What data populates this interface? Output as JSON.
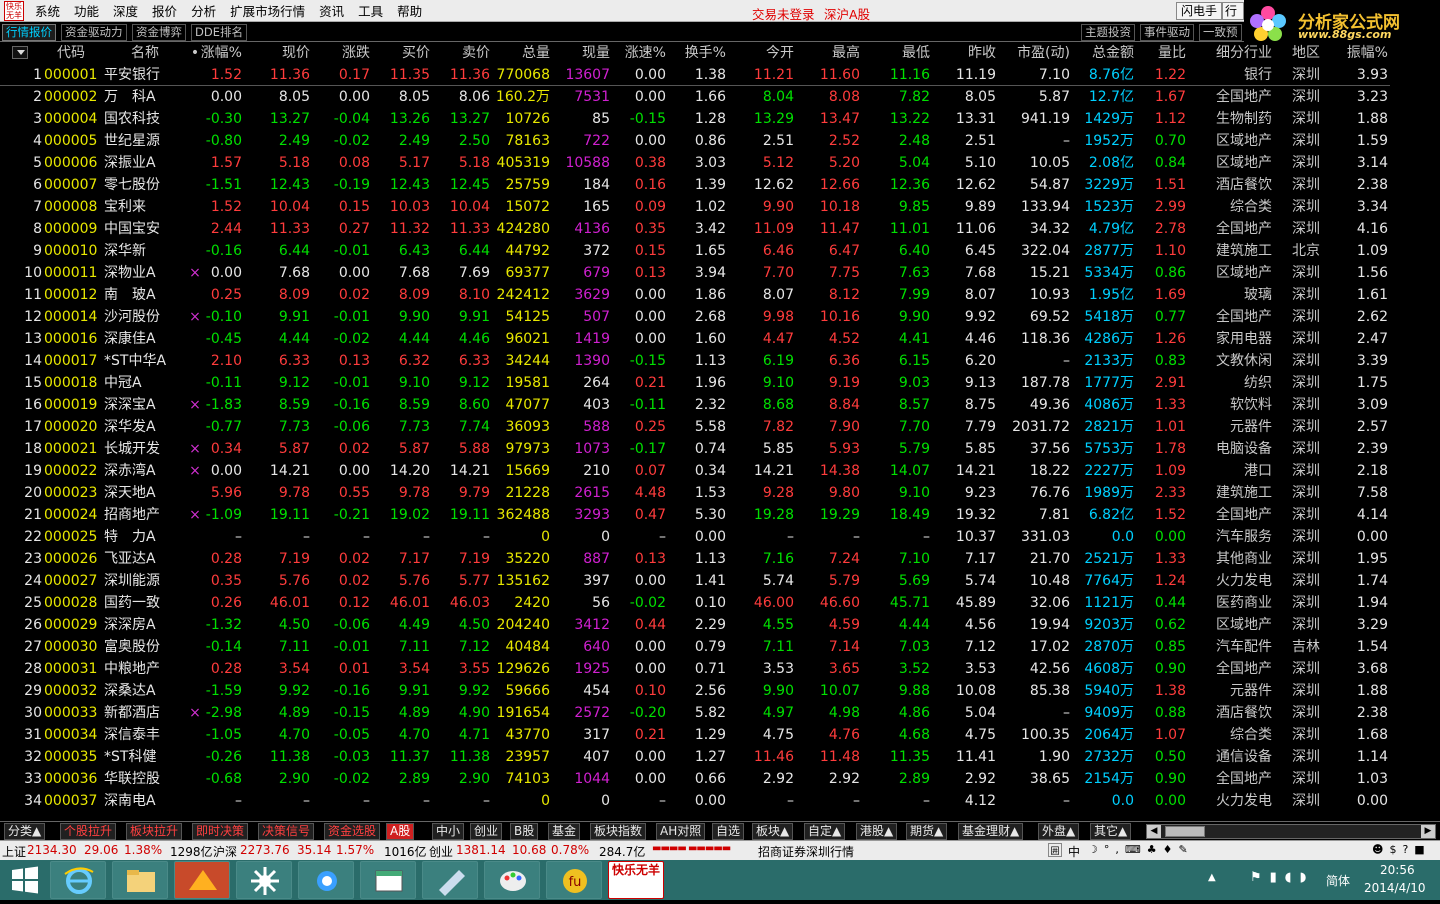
{
  "menu": {
    "logo_text": "快乐无羊",
    "items": [
      "系统",
      "功能",
      "深度",
      "报价",
      "分析",
      "扩展市场行情",
      "资讯",
      "工具",
      "帮助"
    ],
    "login_status": "交易未登录",
    "market_label": "深沪A股",
    "flash_label": "闪电手",
    "mini_label": "行"
  },
  "brand": {
    "title": "分析家公式网",
    "url": "www.88gs.com"
  },
  "tabs": {
    "left": [
      "行情报价",
      "资金驱动力",
      "资金博弈",
      "DDE排名"
    ],
    "right": [
      "主题投资",
      "事件驱动",
      "一致预"
    ]
  },
  "columns": [
    "代码",
    "名称",
    "•",
    "涨幅%",
    "现价",
    "涨跌",
    "买价",
    "卖价",
    "总量",
    "现量",
    "涨速%",
    "换手%",
    "今开",
    "最高",
    "最低",
    "昨收",
    "市盈(动)",
    "总金额",
    "量比",
    "细分行业",
    "地区",
    "振幅%"
  ],
  "rows": [
    [
      "1",
      "000001",
      "平安银行",
      "",
      "1.52",
      "11.36",
      "0.17",
      "11.35",
      "11.36",
      "770068",
      "13607",
      "0.00",
      "1.38",
      "11.21",
      "11.60",
      "11.16",
      "11.19",
      "7.10",
      "8.76亿",
      "1.22",
      "银行",
      "深圳",
      "3.93"
    ],
    [
      "2",
      "000002",
      "万　科A",
      "",
      "0.00",
      "8.05",
      "0.00",
      "8.05",
      "8.06",
      "160.2万",
      "7531",
      "0.00",
      "1.66",
      "8.04",
      "8.08",
      "7.82",
      "8.05",
      "5.87",
      "12.7亿",
      "1.67",
      "全国地产",
      "深圳",
      "3.23"
    ],
    [
      "3",
      "000004",
      "国农科技",
      "",
      "-0.30",
      "13.27",
      "-0.04",
      "13.26",
      "13.27",
      "10726",
      "85",
      "-0.15",
      "1.28",
      "13.29",
      "13.47",
      "13.22",
      "13.31",
      "941.19",
      "1429万",
      "1.12",
      "生物制药",
      "深圳",
      "1.88"
    ],
    [
      "4",
      "000005",
      "世纪星源",
      "",
      "-0.80",
      "2.49",
      "-0.02",
      "2.49",
      "2.50",
      "78163",
      "722",
      "0.00",
      "0.86",
      "2.51",
      "2.52",
      "2.48",
      "2.51",
      "–",
      "1952万",
      "0.70",
      "区域地产",
      "深圳",
      "1.59"
    ],
    [
      "5",
      "000006",
      "深振业A",
      "",
      "1.57",
      "5.18",
      "0.08",
      "5.17",
      "5.18",
      "405319",
      "10588",
      "0.38",
      "3.03",
      "5.12",
      "5.20",
      "5.04",
      "5.10",
      "10.05",
      "2.08亿",
      "0.84",
      "区域地产",
      "深圳",
      "3.14"
    ],
    [
      "6",
      "000007",
      "零七股份",
      "",
      "-1.51",
      "12.43",
      "-0.19",
      "12.43",
      "12.45",
      "25759",
      "184",
      "0.16",
      "1.39",
      "12.62",
      "12.66",
      "12.36",
      "12.62",
      "54.87",
      "3229万",
      "1.51",
      "酒店餐饮",
      "深圳",
      "2.38"
    ],
    [
      "7",
      "000008",
      "宝利来",
      "",
      "1.52",
      "10.04",
      "0.15",
      "10.03",
      "10.04",
      "15072",
      "165",
      "0.09",
      "1.02",
      "9.90",
      "10.18",
      "9.85",
      "9.89",
      "133.94",
      "1523万",
      "2.99",
      "综合类",
      "深圳",
      "3.34"
    ],
    [
      "8",
      "000009",
      "中国宝安",
      "",
      "2.44",
      "11.33",
      "0.27",
      "11.32",
      "11.33",
      "424280",
      "4136",
      "0.35",
      "3.42",
      "11.09",
      "11.47",
      "11.01",
      "11.06",
      "34.32",
      "4.79亿",
      "2.78",
      "全国地产",
      "深圳",
      "4.16"
    ],
    [
      "9",
      "000010",
      "深华新",
      "",
      "-0.16",
      "6.44",
      "-0.01",
      "6.43",
      "6.44",
      "44792",
      "372",
      "0.15",
      "1.65",
      "6.46",
      "6.47",
      "6.40",
      "6.45",
      "322.04",
      "2877万",
      "1.10",
      "建筑施工",
      "北京",
      "1.09"
    ],
    [
      "10",
      "000011",
      "深物业A",
      "×",
      "0.00",
      "7.68",
      "0.00",
      "7.68",
      "7.69",
      "69377",
      "679",
      "0.13",
      "3.94",
      "7.70",
      "7.75",
      "7.63",
      "7.68",
      "15.21",
      "5334万",
      "0.86",
      "区域地产",
      "深圳",
      "1.56"
    ],
    [
      "11",
      "000012",
      "南　玻A",
      "",
      "0.25",
      "8.09",
      "0.02",
      "8.09",
      "8.10",
      "242412",
      "3629",
      "0.00",
      "1.86",
      "8.07",
      "8.12",
      "7.99",
      "8.07",
      "10.93",
      "1.95亿",
      "1.69",
      "玻璃",
      "深圳",
      "1.61"
    ],
    [
      "12",
      "000014",
      "沙河股份",
      "×",
      "-0.10",
      "9.91",
      "-0.01",
      "9.90",
      "9.91",
      "54125",
      "507",
      "0.00",
      "2.68",
      "9.98",
      "10.16",
      "9.90",
      "9.92",
      "69.52",
      "5418万",
      "0.77",
      "全国地产",
      "深圳",
      "2.62"
    ],
    [
      "13",
      "000016",
      "深康佳A",
      "",
      "-0.45",
      "4.44",
      "-0.02",
      "4.44",
      "4.46",
      "96021",
      "1419",
      "0.00",
      "1.60",
      "4.47",
      "4.52",
      "4.41",
      "4.46",
      "118.36",
      "4286万",
      "1.26",
      "家用电器",
      "深圳",
      "2.47"
    ],
    [
      "14",
      "000017",
      "*ST中华A",
      "",
      "2.10",
      "6.33",
      "0.13",
      "6.32",
      "6.33",
      "34244",
      "1390",
      "-0.15",
      "1.13",
      "6.19",
      "6.36",
      "6.15",
      "6.20",
      "–",
      "2133万",
      "0.83",
      "文教休闲",
      "深圳",
      "3.39"
    ],
    [
      "15",
      "000018",
      "中冠A",
      "",
      "-0.11",
      "9.12",
      "-0.01",
      "9.10",
      "9.12",
      "19581",
      "264",
      "0.21",
      "1.96",
      "9.10",
      "9.19",
      "9.03",
      "9.13",
      "187.78",
      "1777万",
      "2.91",
      "纺织",
      "深圳",
      "1.75"
    ],
    [
      "16",
      "000019",
      "深深宝A",
      "×",
      "-1.83",
      "8.59",
      "-0.16",
      "8.59",
      "8.60",
      "47077",
      "403",
      "-0.11",
      "2.32",
      "8.68",
      "8.84",
      "8.57",
      "8.75",
      "49.36",
      "4086万",
      "1.33",
      "软饮料",
      "深圳",
      "3.09"
    ],
    [
      "17",
      "000020",
      "深华发A",
      "",
      "-0.77",
      "7.73",
      "-0.06",
      "7.73",
      "7.74",
      "36093",
      "588",
      "0.25",
      "5.58",
      "7.82",
      "7.90",
      "7.70",
      "7.79",
      "2031.72",
      "2821万",
      "1.01",
      "元器件",
      "深圳",
      "2.57"
    ],
    [
      "18",
      "000021",
      "长城开发",
      "×",
      "0.34",
      "5.87",
      "0.02",
      "5.87",
      "5.88",
      "97973",
      "1073",
      "-0.17",
      "0.74",
      "5.85",
      "5.93",
      "5.79",
      "5.85",
      "37.56",
      "5753万",
      "1.78",
      "电脑设备",
      "深圳",
      "2.39"
    ],
    [
      "19",
      "000022",
      "深赤湾A",
      "×",
      "0.00",
      "14.21",
      "0.00",
      "14.20",
      "14.21",
      "15669",
      "210",
      "0.07",
      "0.34",
      "14.21",
      "14.38",
      "14.07",
      "14.21",
      "18.22",
      "2227万",
      "1.09",
      "港口",
      "深圳",
      "2.18"
    ],
    [
      "20",
      "000023",
      "深天地A",
      "",
      "5.96",
      "9.78",
      "0.55",
      "9.78",
      "9.79",
      "21228",
      "2615",
      "4.48",
      "1.53",
      "9.28",
      "9.80",
      "9.10",
      "9.23",
      "76.76",
      "1989万",
      "2.33",
      "建筑施工",
      "深圳",
      "7.58"
    ],
    [
      "21",
      "000024",
      "招商地产",
      "×",
      "-1.09",
      "19.11",
      "-0.21",
      "19.02",
      "19.11",
      "362488",
      "3293",
      "0.47",
      "5.30",
      "19.28",
      "19.29",
      "18.49",
      "19.32",
      "7.81",
      "6.82亿",
      "1.52",
      "全国地产",
      "深圳",
      "4.14"
    ],
    [
      "22",
      "000025",
      "特　力A",
      "",
      "–",
      "–",
      "–",
      "–",
      "–",
      "0",
      "0",
      "–",
      "0.00",
      "–",
      "–",
      "–",
      "10.37",
      "331.03",
      "0.0",
      "0.00",
      "汽车服务",
      "深圳",
      "0.00"
    ],
    [
      "23",
      "000026",
      "飞亚达A",
      "",
      "0.28",
      "7.19",
      "0.02",
      "7.17",
      "7.19",
      "35220",
      "887",
      "0.13",
      "1.13",
      "7.16",
      "7.24",
      "7.10",
      "7.17",
      "21.70",
      "2521万",
      "1.33",
      "其他商业",
      "深圳",
      "1.95"
    ],
    [
      "24",
      "000027",
      "深圳能源",
      "",
      "0.35",
      "5.76",
      "0.02",
      "5.76",
      "5.77",
      "135162",
      "397",
      "0.00",
      "1.41",
      "5.74",
      "5.79",
      "5.69",
      "5.74",
      "10.48",
      "7764万",
      "1.24",
      "火力发电",
      "深圳",
      "1.74"
    ],
    [
      "25",
      "000028",
      "国药一致",
      "",
      "0.26",
      "46.01",
      "0.12",
      "46.01",
      "46.03",
      "2420",
      "56",
      "-0.02",
      "0.10",
      "46.00",
      "46.60",
      "45.71",
      "45.89",
      "32.06",
      "1121万",
      "0.44",
      "医药商业",
      "深圳",
      "1.94"
    ],
    [
      "26",
      "000029",
      "深深房A",
      "",
      "-1.32",
      "4.50",
      "-0.06",
      "4.49",
      "4.50",
      "204240",
      "3412",
      "0.44",
      "2.29",
      "4.55",
      "4.59",
      "4.44",
      "4.56",
      "19.94",
      "9203万",
      "0.62",
      "区域地产",
      "深圳",
      "3.29"
    ],
    [
      "27",
      "000030",
      "富奥股份",
      "",
      "-0.14",
      "7.11",
      "-0.01",
      "7.11",
      "7.12",
      "40484",
      "640",
      "0.00",
      "0.79",
      "7.11",
      "7.14",
      "7.03",
      "7.12",
      "17.02",
      "2870万",
      "0.85",
      "汽车配件",
      "吉林",
      "1.54"
    ],
    [
      "28",
      "000031",
      "中粮地产",
      "",
      "0.28",
      "3.54",
      "0.01",
      "3.54",
      "3.55",
      "129626",
      "1925",
      "0.00",
      "0.71",
      "3.53",
      "3.65",
      "3.52",
      "3.53",
      "42.56",
      "4608万",
      "0.90",
      "全国地产",
      "深圳",
      "3.68"
    ],
    [
      "29",
      "000032",
      "深桑达A",
      "",
      "-1.59",
      "9.92",
      "-0.16",
      "9.91",
      "9.92",
      "59666",
      "454",
      "0.10",
      "2.56",
      "9.90",
      "10.07",
      "9.88",
      "10.08",
      "85.38",
      "5940万",
      "1.38",
      "元器件",
      "深圳",
      "1.88"
    ],
    [
      "30",
      "000033",
      "新都酒店",
      "×",
      "-2.98",
      "4.89",
      "-0.15",
      "4.89",
      "4.90",
      "191654",
      "2572",
      "-0.20",
      "5.82",
      "4.97",
      "4.98",
      "4.86",
      "5.04",
      "–",
      "9409万",
      "0.88",
      "酒店餐饮",
      "深圳",
      "2.38"
    ],
    [
      "31",
      "000034",
      "深信泰丰",
      "",
      "-1.05",
      "4.70",
      "-0.05",
      "4.70",
      "4.71",
      "43770",
      "317",
      "0.21",
      "1.29",
      "4.75",
      "4.76",
      "4.68",
      "4.75",
      "100.35",
      "2064万",
      "1.07",
      "综合类",
      "深圳",
      "1.68"
    ],
    [
      "32",
      "000035",
      "*ST科健",
      "",
      "-0.26",
      "11.38",
      "-0.03",
      "11.37",
      "11.38",
      "23957",
      "407",
      "0.00",
      "1.27",
      "11.46",
      "11.48",
      "11.35",
      "11.41",
      "1.90",
      "2732万",
      "0.50",
      "通信设备",
      "深圳",
      "1.14"
    ],
    [
      "33",
      "000036",
      "华联控股",
      "",
      "-0.68",
      "2.90",
      "-0.02",
      "2.89",
      "2.90",
      "74103",
      "1044",
      "0.00",
      "0.66",
      "2.92",
      "2.92",
      "2.89",
      "2.92",
      "38.65",
      "2154万",
      "0.90",
      "全国地产",
      "深圳",
      "1.03"
    ],
    [
      "34",
      "000037",
      "深南电A",
      "",
      "–",
      "–",
      "–",
      "–",
      "–",
      "0",
      "0",
      "–",
      "0.00",
      "–",
      "–",
      "–",
      "4.12",
      "–",
      "0.0",
      "0.00",
      "火力发电",
      "深圳",
      "0.00"
    ]
  ],
  "bottom_tabs": [
    "分类▲",
    "个股拉升",
    "板块拉升",
    "即时决策",
    "决策信号",
    "资金选股",
    "A股",
    "中小",
    "创业",
    "B股",
    "基金",
    "板块指数",
    "AH对照",
    "自选",
    "板块▲",
    "自定▲",
    "港股▲",
    "期货▲",
    "基金理财▲",
    "外盘▲",
    "其它▲"
  ],
  "status": {
    "sh_label": "上证",
    "sh_index": "2134.30",
    "sh_change": "29.06",
    "sh_pct": "1.38%",
    "sh_amount": "1298亿",
    "hs_label": "沪深",
    "hs_index": "2273.76",
    "hs_change": "35.14",
    "hs_pct": "1.57%",
    "hs_amount": "1016亿",
    "cy_label": "创业",
    "cy_index": "1381.14",
    "cy_change": "10.68",
    "cy_pct": "0.78%",
    "cy_amount": "284.7亿",
    "broker": "招商证券深圳行情",
    "ime": "中"
  },
  "taskbar": {
    "time": "20:56",
    "date": "2014/4/10",
    "lang": "简体",
    "app_label": "快乐无羊"
  },
  "colors": {
    "up": "#ff3c3c",
    "down": "#00e000",
    "neutral": "#e6e6e6",
    "code": "#e8e800",
    "vol": "#d020d0",
    "amount": "#00d0ff",
    "industry": "#c8c8c8"
  }
}
